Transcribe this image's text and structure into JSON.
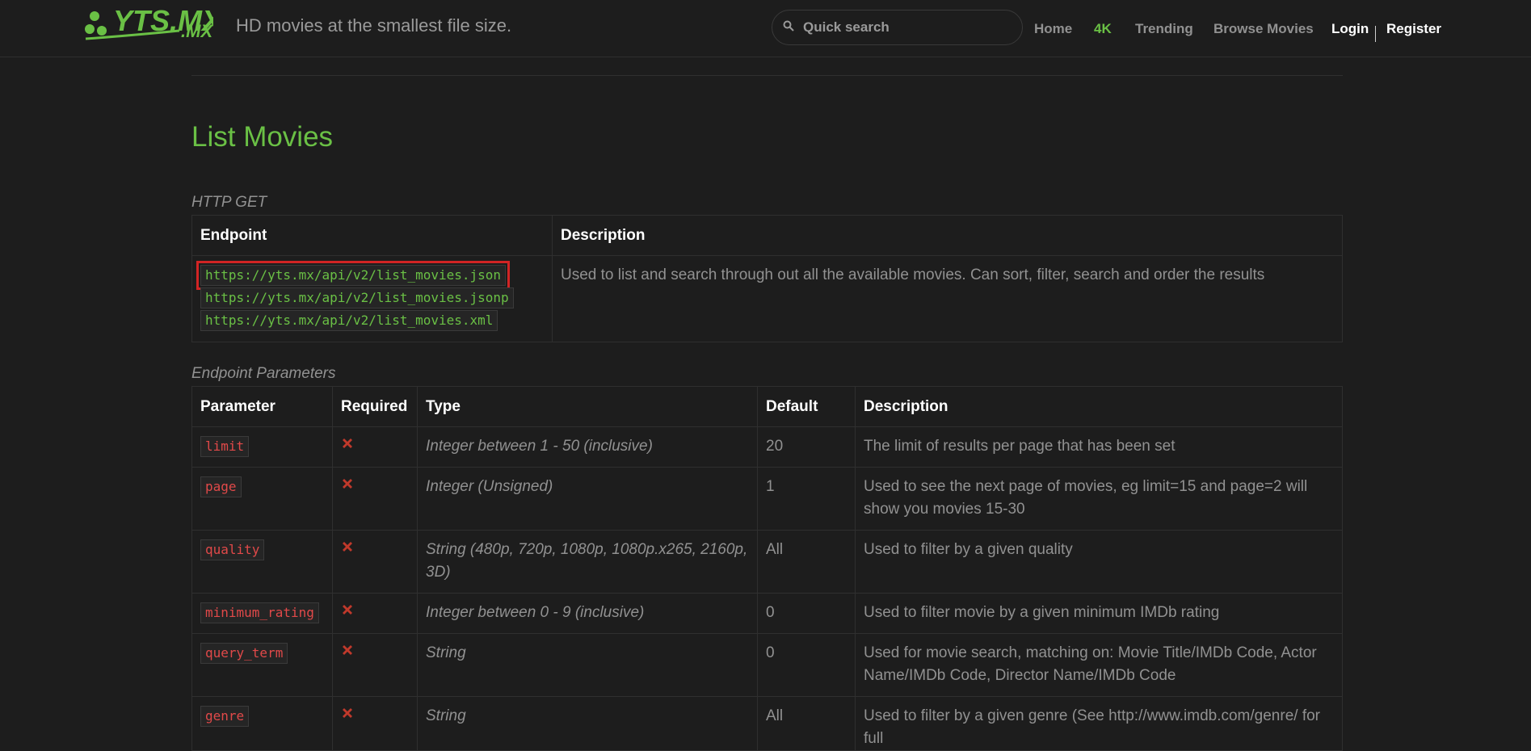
{
  "header": {
    "logo_text": "YTS.MX",
    "tagline": "HD movies at the smallest file size.",
    "search_placeholder": "Quick search",
    "nav": [
      {
        "label": "Home",
        "active": false
      },
      {
        "label": "4K",
        "active": true
      },
      {
        "label": "Trending",
        "active": false
      },
      {
        "label": "Browse Movies",
        "active": false
      },
      {
        "label": "Login",
        "active": false
      },
      {
        "label": "Register",
        "active": false
      }
    ]
  },
  "main": {
    "title": "List Movies",
    "method_caption": "HTTP GET",
    "endpoint_table": {
      "headers": [
        "Endpoint",
        "Description"
      ],
      "endpoints": [
        "https://yts.mx/api/v2/list_movies.json",
        "https://yts.mx/api/v2/list_movies.jsonp",
        "https://yts.mx/api/v2/list_movies.xml"
      ],
      "description": "Used to list and search through out all the available movies. Can sort, filter, search and order the results"
    },
    "params_caption": "Endpoint Parameters",
    "params_table": {
      "headers": [
        "Parameter",
        "Required",
        "Type",
        "Default",
        "Description"
      ],
      "rows": [
        {
          "param": "limit",
          "type": "Integer between 1 - 50 (inclusive)",
          "default": "20",
          "description": "The limit of results per page that has been set"
        },
        {
          "param": "page",
          "type": "Integer (Unsigned)",
          "default": "1",
          "description": "Used to see the next page of movies, eg limit=15 and page=2 will show you movies 15-30"
        },
        {
          "param": "quality",
          "type": "String (480p, 720p, 1080p, 1080p.x265, 2160p, 3D)",
          "default": "All",
          "description": "Used to filter by a given quality"
        },
        {
          "param": "minimum_rating",
          "type": "Integer between 0 - 9 (inclusive)",
          "default": "0",
          "description": "Used to filter movie by a given minimum IMDb rating"
        },
        {
          "param": "query_term",
          "type": "String",
          "default": "0",
          "description": "Used for movie search, matching on: Movie Title/IMDb Code, Actor Name/IMDb Code, Director Name/IMDb Code"
        },
        {
          "param": "genre",
          "type": "String",
          "default": "All",
          "description": "Used to filter by a given genre (See http://www.imdb.com/genre/ for full"
        }
      ]
    }
  },
  "colors": {
    "accent": "#6ac045",
    "background": "#1d1d1d",
    "required_x": "#c0392b",
    "highlight_box": "#d22424"
  }
}
